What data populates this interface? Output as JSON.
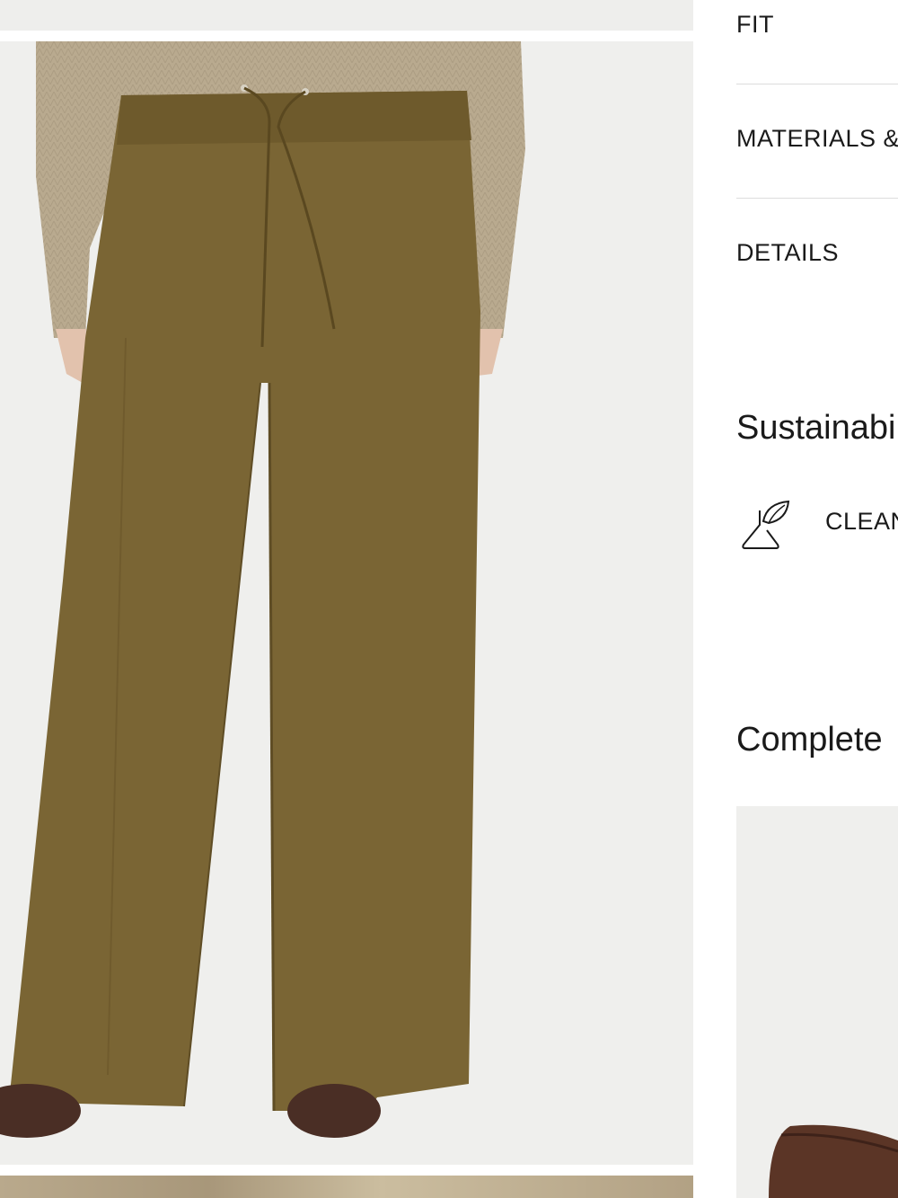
{
  "gallery": {
    "main_image_alt": "Olive brown wide-leg drawstring trousers worn with beige knit sweater and brown shoes",
    "colors": {
      "background": "#efefed",
      "trousers": "#7a6534",
      "sweater": "#b9aa8f",
      "shoes": "#4a2e25"
    }
  },
  "accordion": {
    "fit": "FIT",
    "materials": "MATERIALS &",
    "details": "DETAILS"
  },
  "sustainability": {
    "title": "Sustainabi",
    "badge_label": "CLEAN",
    "icon": "leaf-flask-icon"
  },
  "complete_the_look": {
    "title": "Complete",
    "product_icon": "shoe-image"
  }
}
